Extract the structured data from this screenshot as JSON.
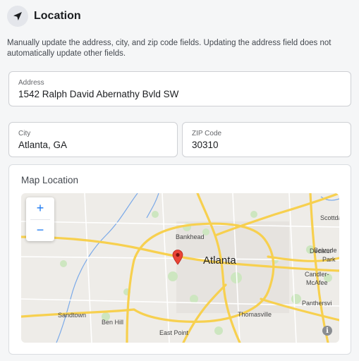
{
  "header": {
    "title": "Location",
    "icon": "navigation-arrow-icon"
  },
  "description": "Manually update the address, city, and zip code fields. Updating the address field does not automatically update other fields.",
  "fields": {
    "address": {
      "label": "Address",
      "value": "1542 Ralph David Abernathy Bvld SW"
    },
    "city": {
      "label": "City",
      "value": "Atlanta, GA"
    },
    "zip": {
      "label": "ZIP Code",
      "value": "30310"
    }
  },
  "map": {
    "title": "Map Location",
    "zoom_in": "+",
    "zoom_out": "−",
    "info": "i",
    "labels": {
      "atlanta": "Atlanta",
      "bankhead": "Bankhead",
      "decatur": "Decatur",
      "scottdale": "Scottda",
      "belvedere": "Belvede",
      "park": "Park",
      "candler": "Candler-",
      "mcafee": "McAfee",
      "panthersville": "Panthersvi",
      "sandtown": "Sandtown",
      "benhill": "Ben Hill",
      "thomasville": "Thomasville",
      "eastpoint": "East Point"
    },
    "marker_color": "#ea4335",
    "road_color": "#f7d04f"
  }
}
